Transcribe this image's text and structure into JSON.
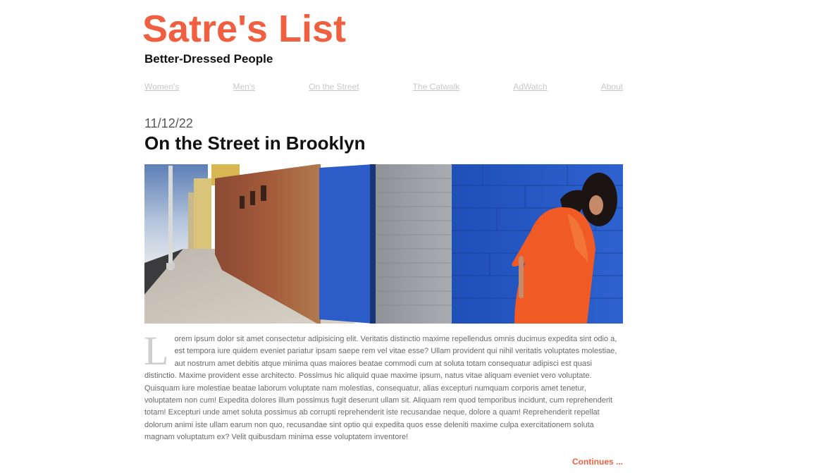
{
  "site": {
    "title": "Satre's List",
    "tagline": "Better-Dressed People",
    "accent_color": "#f06040"
  },
  "nav": {
    "items": [
      {
        "label": "Women's"
      },
      {
        "label": "Men's"
      },
      {
        "label": "On the Street"
      },
      {
        "label": "The Catwalk"
      },
      {
        "label": "AdWatch"
      },
      {
        "label": "About"
      }
    ]
  },
  "post": {
    "date": "11/12/22",
    "title": "On the Street in Brooklyn",
    "image_alt_icon": "street-photo",
    "drop_cap": "L",
    "body": "orem ipsum dolor sit amet consectetur adipisicing elit. Veritatis distinctio maxime repellendus omnis ducimus expedita sint odio a, est tempora iure quidem eveniet pariatur ipsam saepe rem vel vitae esse? Ullam provident qui nihil veritatis voluptates molestiae, aut nostrum amet debitis atque minima quas maiores beatae commodi cum at soluta totam consequatur adipisci est quasi distinctio. Maxime provident esse architecto. Possimus hic aliquid quae maxime ipsum, natus vitae aliquam eveniet vero voluptate. Quisquam iure molestiae beatae laborum voluptate nam molestias, consequatur, alias excepturi numquam corporis amet tenetur, voluptatem non cum! Expedita dolores illum possimus fugit deserunt ullam sit. Aliquam rem quod temporibus incidunt, cum reprehenderit totam! Excepturi unde amet soluta possimus ab corrupti reprehenderit iste recusandae neque, dolore a quam! Reprehenderit repellat dolorum animi iste ullam earum non quo, recusandae sint optio qui expedita quos esse deleniti maxime culpa exercitationem soluta magnam voluptatum ex? Velit quibusdam minima esse voluptatem inventore!",
    "continue_label": "Continues ..."
  }
}
